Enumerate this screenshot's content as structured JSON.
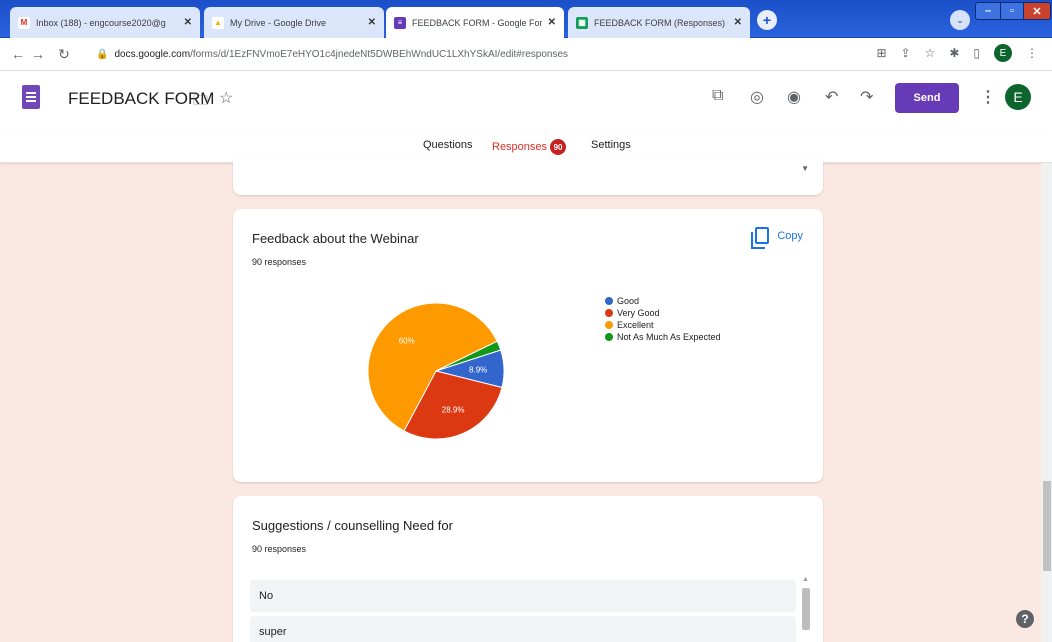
{
  "browser": {
    "tabs": [
      {
        "title": "Inbox (188) - engcourse2020@g",
        "icon": "gmail-icon",
        "color": "#d93025",
        "fav": "M"
      },
      {
        "title": "My Drive - Google Drive",
        "icon": "drive-icon",
        "color": "#f9ab00",
        "fav": "▲"
      },
      {
        "title": "FEEDBACK FORM - Google Form",
        "icon": "forms-icon",
        "color": "#673ab7",
        "fav": "≡"
      },
      {
        "title": "FEEDBACK FORM (Responses) - G",
        "icon": "sheets-icon",
        "color": "#0f9d58",
        "fav": "▦"
      }
    ],
    "new_tab": "+",
    "url_host": "docs.google.com",
    "url_path": "/forms/d/1EzFNVmoE7eHYO1c4jnedeNt5DWBEhWndUC1LXhYSkAI/edit#responses",
    "profile_initial": "E"
  },
  "form_header": {
    "title": "FEEDBACK FORM",
    "send_label": "Send",
    "avatar_initial": "E"
  },
  "form_tabs": [
    {
      "label": "Questions"
    },
    {
      "label": "Responses",
      "badge": "90"
    },
    {
      "label": "Settings"
    }
  ],
  "chart_card": {
    "title": "Feedback about the Webinar",
    "responses": "90 responses",
    "copy_label": "Copy"
  },
  "chart_data": {
    "type": "pie",
    "title": "Feedback about the Webinar",
    "slices": [
      {
        "label": "Good",
        "value": 8.9,
        "color": "#3366cc",
        "text": "8.9%"
      },
      {
        "label": "Very Good",
        "value": 28.9,
        "color": "#dc3912",
        "text": "28.9%"
      },
      {
        "label": "Excellent",
        "value": 60,
        "color": "#ff9900",
        "text": "60%"
      },
      {
        "label": "Not As Much As Expected",
        "value": 2.2,
        "color": "#109618",
        "text": ""
      }
    ],
    "legend_position": "right"
  },
  "suggestions_card": {
    "title": "Suggestions / counselling Need for",
    "responses": "90 responses",
    "items": [
      "No",
      "super"
    ]
  }
}
